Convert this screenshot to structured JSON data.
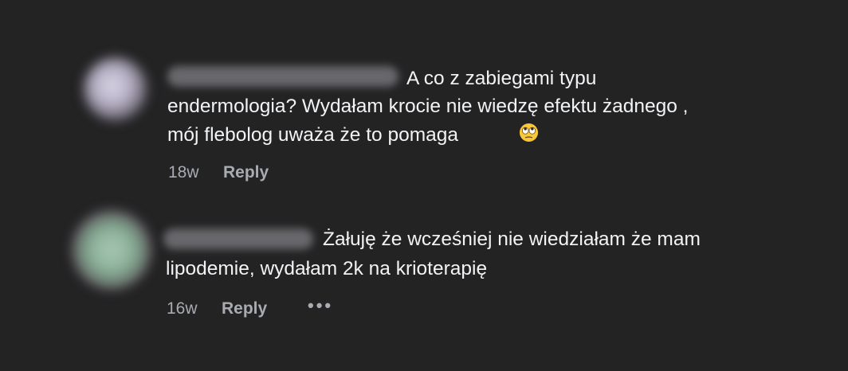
{
  "comments": [
    {
      "lines": [
        "A co z zabiegami typu",
        "endermologia? Wydałam krocie nie wiedzę efektu żadnego ,",
        "mój flebolog uważa że to pomaga"
      ],
      "emoji": "face-with-rolling-eyes",
      "time": "18w",
      "reply_label": "Reply"
    },
    {
      "lines": [
        "Żałuję że wcześniej nie wiedziałam że mam",
        "lipodemie, wydałam 2k na krioterapię"
      ],
      "time": "16w",
      "reply_label": "Reply",
      "more_label": "•••"
    }
  ],
  "colors": {
    "background": "#232324",
    "text": "#f2f3f5",
    "meta": "#a8abb0"
  }
}
